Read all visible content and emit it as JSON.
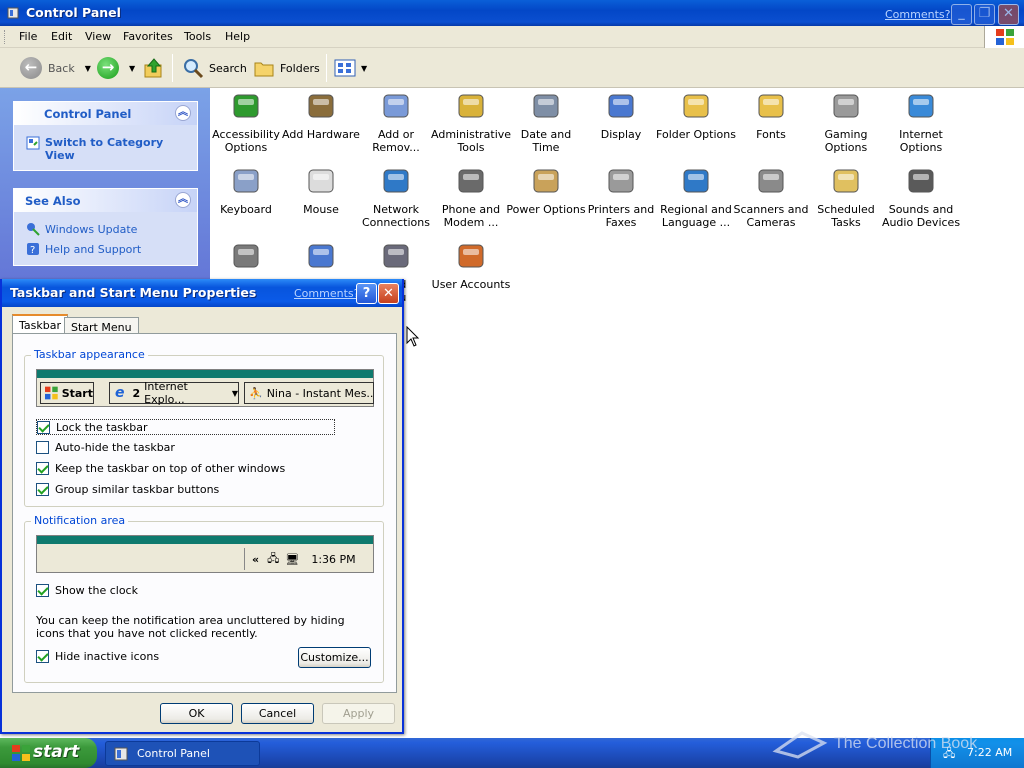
{
  "window": {
    "title": "Control Panel",
    "comments_link": "Comments?",
    "menu": [
      "File",
      "Edit",
      "View",
      "Favorites",
      "Tools",
      "Help"
    ],
    "toolbar": {
      "back": "Back",
      "search": "Search",
      "folders": "Folders"
    }
  },
  "sidebar": {
    "control_panel": {
      "title": "Control Panel",
      "link": "Switch to Category View"
    },
    "see_also": {
      "title": "See Also",
      "links": [
        "Windows Update",
        "Help and Support"
      ]
    }
  },
  "icons": [
    [
      "Accessibility",
      "Options"
    ],
    [
      "Add Hardware",
      ""
    ],
    [
      "Add or",
      "Remov..."
    ],
    [
      "Administrative",
      "Tools"
    ],
    [
      "Date and Time",
      ""
    ],
    [
      "Display",
      ""
    ],
    [
      "Folder Options",
      ""
    ],
    [
      "Fonts",
      ""
    ],
    [
      "Gaming",
      "Options"
    ],
    [
      "Internet",
      "Options"
    ],
    [
      "Keyboard",
      ""
    ],
    [
      "Mouse",
      ""
    ],
    [
      "Network",
      "Connections"
    ],
    [
      "Phone and",
      "Modem ..."
    ],
    [
      "Power Options",
      ""
    ],
    [
      "Printers and",
      "Faxes"
    ],
    [
      "Regional and",
      "Language ..."
    ],
    [
      "Scanners and",
      "Cameras"
    ],
    [
      "Scheduled",
      "Tasks"
    ],
    [
      "Sounds and",
      "Audio Devices"
    ],
    [
      "",
      ""
    ],
    [
      "",
      ""
    ],
    [
      "and",
      "enu"
    ],
    [
      "User Accounts",
      ""
    ]
  ],
  "dialog": {
    "title": "Taskbar and Start Menu Properties",
    "comments_link": "Comments?",
    "tabs": [
      "Taskbar",
      "Start Menu"
    ],
    "appearance": {
      "legend": "Taskbar appearance",
      "preview": {
        "start": "Start",
        "ie_count": "2",
        "ie_label": "Internet Explo...",
        "im_label": "Nina - Instant Mes..."
      },
      "options": [
        {
          "label": "Lock the taskbar",
          "checked": true
        },
        {
          "label": "Auto-hide the taskbar",
          "checked": false
        },
        {
          "label": "Keep the taskbar on top of other windows",
          "checked": true
        },
        {
          "label": "Group similar taskbar buttons",
          "checked": true
        }
      ]
    },
    "notification": {
      "legend": "Notification area",
      "preview_time": "1:36 PM",
      "preview_arrows": "«",
      "show_clock": {
        "label": "Show the clock",
        "checked": true
      },
      "description": "You can keep the notification area uncluttered by hiding icons that you have not clicked recently.",
      "hide_inactive": {
        "label": "Hide inactive icons",
        "checked": true
      },
      "customize": "Customize..."
    },
    "buttons": {
      "ok": "OK",
      "cancel": "Cancel",
      "apply": "Apply"
    }
  },
  "taskbar": {
    "start": "start",
    "task": "Control Panel",
    "clock": "7:22 AM"
  },
  "watermark": "The Collection Book"
}
